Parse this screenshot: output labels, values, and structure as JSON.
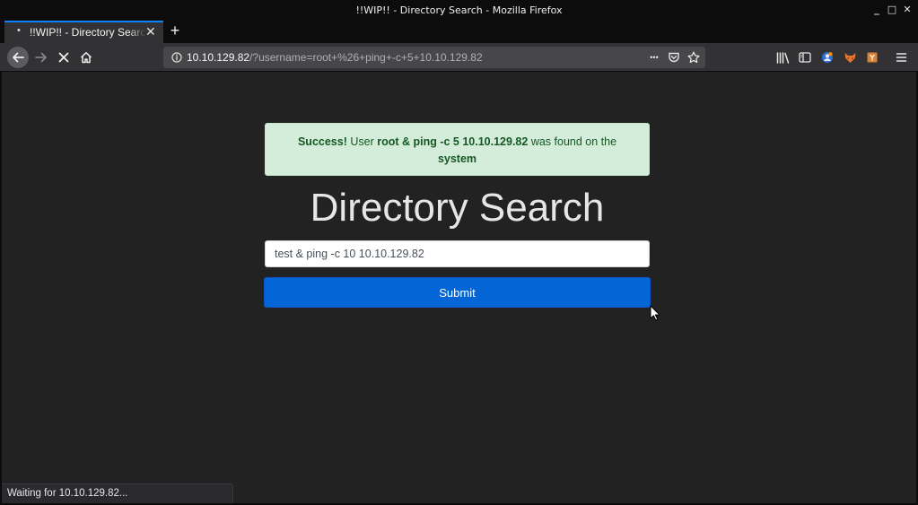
{
  "window": {
    "title": "!!WIP!! - Directory Search - Mozilla Firefox",
    "minimize_glyph": "_",
    "maximize_glyph": "□",
    "close_glyph": "✕"
  },
  "tab": {
    "dot": "•",
    "label": "!!WIP!! - Directory Search",
    "close_glyph": "✕",
    "newtab_glyph": "+"
  },
  "url": {
    "host": "10.10.129.82",
    "path": "/?username=root+%26+ping+-c+5+10.10.129.82",
    "more_glyph": "•••"
  },
  "alert": {
    "strong": "Success!",
    "text1": " User ",
    "user": "root & ping -c 5 10.10.129.82",
    "text2": " was found on the ",
    "last": "system"
  },
  "page": {
    "heading": "Directory Search",
    "input_value": "test & ping -c 10 10.10.129.82",
    "submit_label": "Submit"
  },
  "status": {
    "text": "Waiting for 10.10.129.82..."
  },
  "colors": {
    "accent": "#0a84ff",
    "submit": "#0466d6",
    "alert_bg": "#d4edda",
    "alert_text": "#155724"
  },
  "icons": [
    "back-arrow-icon",
    "forward-arrow-icon",
    "stop-icon",
    "home-icon",
    "info-icon",
    "pocket-icon",
    "star-icon",
    "library-icon",
    "sidebar-icon",
    "account-icon",
    "extension-fox-icon",
    "extension-box-icon",
    "hamburger-menu-icon",
    "mouse-cursor-icon"
  ]
}
